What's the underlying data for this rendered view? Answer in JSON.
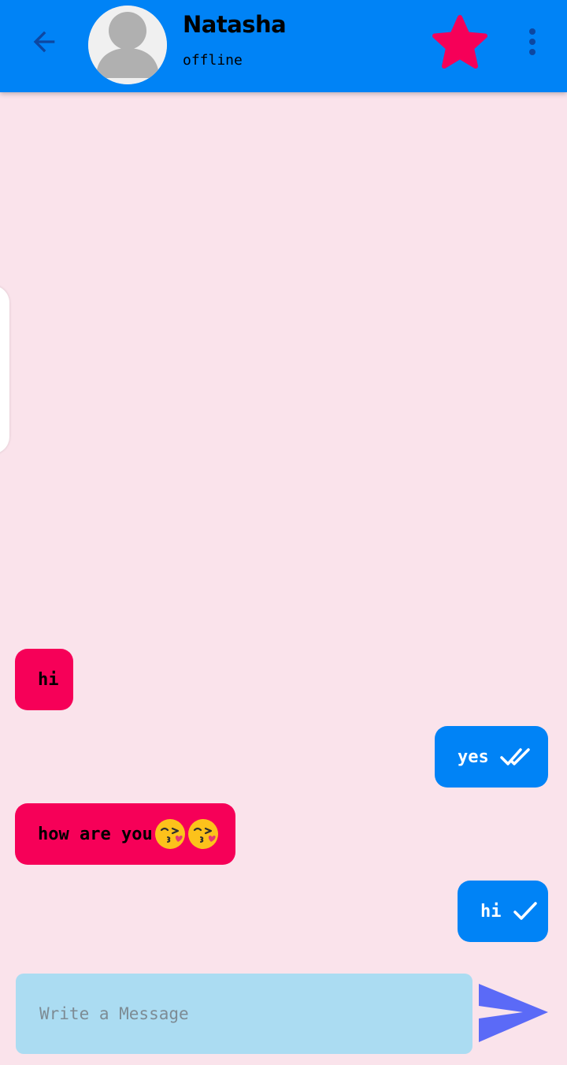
{
  "header": {
    "contact_name": "Natasha",
    "status": "offline",
    "background_color": "#0083f6",
    "favorite_color": "#f60058",
    "icons": {
      "back": "arrow-left-icon",
      "avatar": "default-person-avatar",
      "favorite": "star-icon",
      "more": "more-vertical-icon"
    }
  },
  "messages": [
    {
      "direction": "incoming",
      "text": "hi",
      "emoji": ""
    },
    {
      "direction": "outgoing",
      "text": "yes",
      "receipt": "double-check-icon"
    },
    {
      "direction": "incoming",
      "text": "how are you",
      "emoji": "😘😘"
    },
    {
      "direction": "outgoing",
      "text": "hi",
      "receipt": "single-check-icon"
    }
  ],
  "composer": {
    "placeholder": "Write a Message",
    "value": "",
    "send_icon": "send-icon"
  },
  "colors": {
    "chat_background": "#fae3eb",
    "incoming_bubble": "#f60058",
    "outgoing_bubble": "#0083f6",
    "composer_background": "#abdcf2",
    "send_icon": "#5b6af7"
  }
}
